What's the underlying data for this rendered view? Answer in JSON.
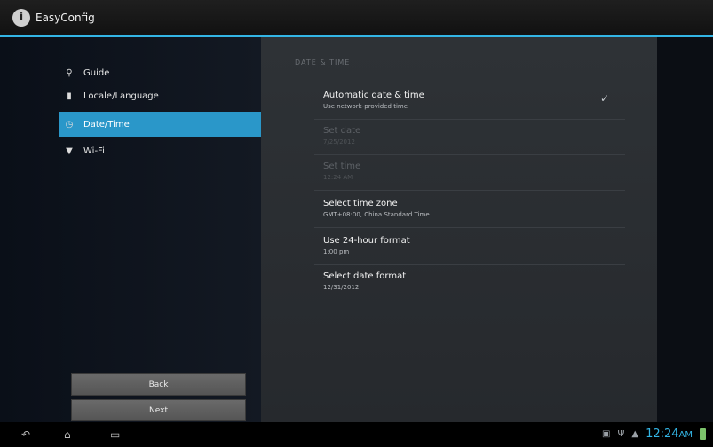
{
  "app": {
    "title": "EasyConfig",
    "icon_name": "info-icon"
  },
  "sidebar": {
    "items": [
      {
        "label": "Guide",
        "icon": "guide-icon"
      },
      {
        "label": "Locale/Language",
        "icon": "language-icon"
      },
      {
        "label": "Date/Time",
        "icon": "clock-icon"
      },
      {
        "label": "Wi-Fi",
        "icon": "wifi-icon"
      }
    ],
    "selected_index": 2,
    "buttons": {
      "back": "Back",
      "next": "Next"
    }
  },
  "settings": {
    "section_header": "DATE & TIME",
    "auto_date_time": {
      "title": "Automatic date & time",
      "summary": "Use network-provided time",
      "checked": true
    },
    "set_date": {
      "title": "Set date",
      "summary": "7/25/2012"
    },
    "set_time": {
      "title": "Set time",
      "summary": "12:24 AM"
    },
    "time_zone": {
      "title": "Select time zone",
      "summary": "GMT+08:00, China Standard Time"
    },
    "hour_format": {
      "title": "Use 24-hour format",
      "summary": "1:00 pm"
    },
    "date_format": {
      "title": "Select date format",
      "summary": "12/31/2012"
    }
  },
  "system_bar": {
    "clock": "12:24",
    "am_pm": "AM",
    "icons": [
      "back-icon",
      "home-icon",
      "recent-apps-icon",
      "screenshot-icon",
      "usb-icon",
      "wifi-signal-icon",
      "battery-icon"
    ]
  },
  "colors": {
    "accent": "#33b5e5",
    "selected_bg": "#2a97c9"
  }
}
